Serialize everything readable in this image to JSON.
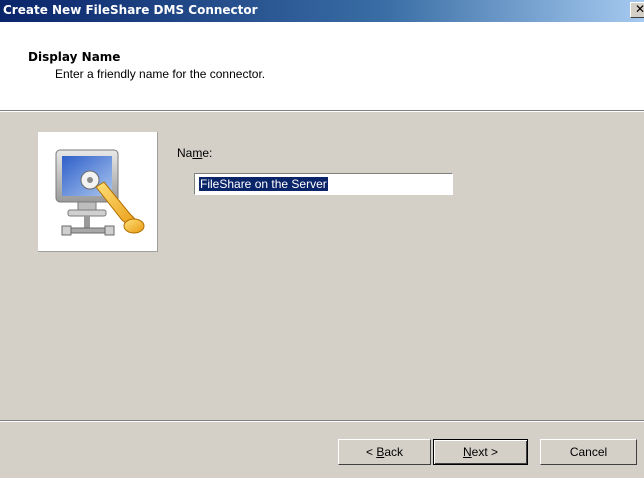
{
  "window": {
    "title": "Create New FileShare DMS Connector",
    "close_glyph": "✕"
  },
  "header": {
    "title": "Display Name",
    "subtitle": "Enter a friendly name for the connector."
  },
  "form": {
    "name_label_pre": "Na",
    "name_label_accel": "m",
    "name_label_post": "e:",
    "name_value": "FileShare on the Server"
  },
  "buttons": {
    "back_pre": "< ",
    "back_accel": "B",
    "back_post": "ack",
    "next_accel": "N",
    "next_post": "ext >",
    "cancel": "Cancel"
  },
  "icons": {
    "wizard_image": "connector-computer-key-icon",
    "close": "close-icon"
  }
}
